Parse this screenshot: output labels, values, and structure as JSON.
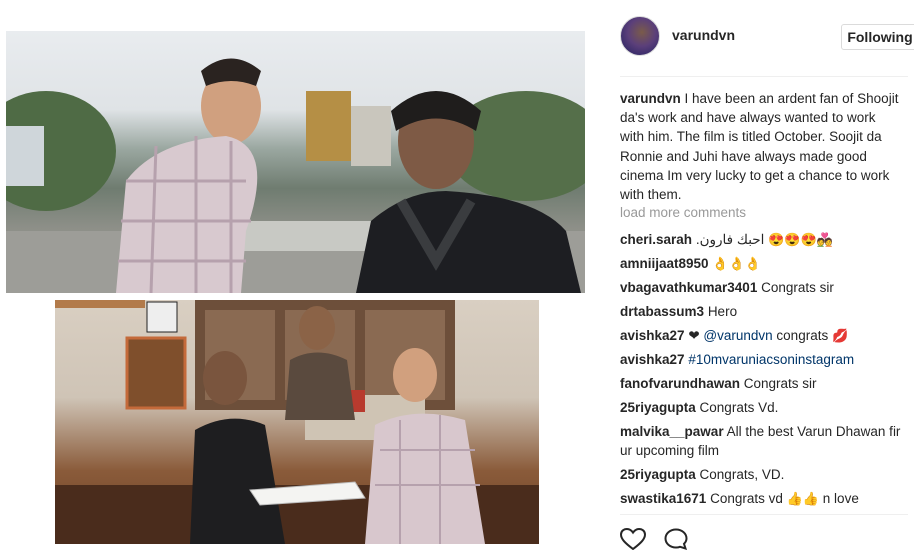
{
  "post": {
    "username": "varundvn",
    "follow_label": "Following",
    "caption_user": "varundvn",
    "caption_text": "I have been an ardent fan of Shoojit da's work and have always wanted to work with him. The film is titled October. Soojit da Ronnie and Juhi have always made good cinema Im very lucky to get a chance to work with them.",
    "load_more": "load more comments"
  },
  "comments": [
    {
      "author": "cheri.sarah",
      "text": "احبك فارون.",
      "emoji": "😍😍😍💑"
    },
    {
      "author": "amniijaat8950",
      "text": "",
      "emoji": "👌👌👌"
    },
    {
      "author": "vbagavathkumar3401",
      "text": "Congrats sir",
      "emoji": ""
    },
    {
      "author": "drtabassum3",
      "text": "Hero",
      "emoji": ""
    },
    {
      "author": "avishka27",
      "text": "❤",
      "mention": "@varundvn",
      "text2": "congrats",
      "emoji": "💋"
    },
    {
      "author": "avishka27",
      "mention": "#10mvaruniacsoninstagram"
    },
    {
      "author": "fanofvarundhawan",
      "text": "Congrats sir"
    },
    {
      "author": "25riyagupta",
      "text": "Congrats Vd."
    },
    {
      "author": "malvika__pawar",
      "text": "All the best Varun Dhawan fir ur upcoming film"
    },
    {
      "author": "25riyagupta",
      "text": "Congrats, VD."
    },
    {
      "author": "swastika1671",
      "text": "Congrats vd",
      "emoji": "👍👍",
      "text2": "n love"
    }
  ],
  "icons": {
    "heart": "heart-icon",
    "comment": "comment-bubble-icon"
  }
}
